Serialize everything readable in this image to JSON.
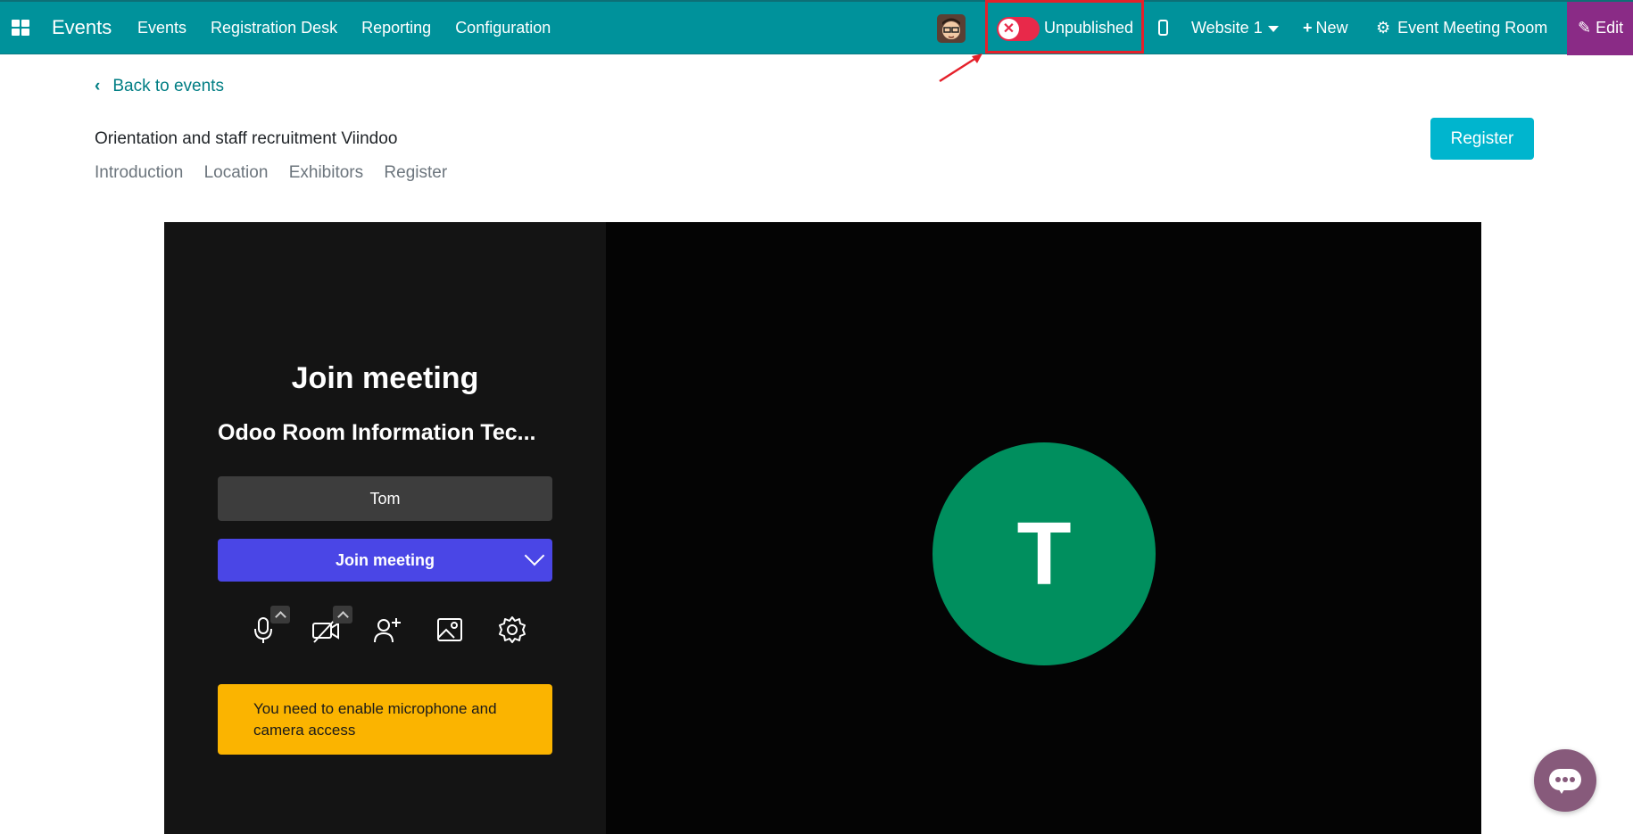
{
  "navbar": {
    "app_name": "Events",
    "menu": [
      "Events",
      "Registration Desk",
      "Reporting",
      "Configuration"
    ],
    "publish_status": "Unpublished",
    "website": "Website 1",
    "new_label": "New",
    "room_label": "Event Meeting Room",
    "edit_label": "Edit",
    "colors": {
      "bar": "#00929b",
      "edit": "#8a2b86",
      "toggle": "#e8294a",
      "highlight_box": "#e5202a"
    }
  },
  "page": {
    "back_label": "Back to events",
    "event_title": "Orientation and staff recruitment Viindoo",
    "tabs": [
      "Introduction",
      "Location",
      "Exhibitors",
      "Register"
    ],
    "register_label": "Register"
  },
  "meeting": {
    "join_title": "Join meeting",
    "room_name": "Odoo Room Information Tec...",
    "participant_name": "Tom",
    "join_button": "Join meeting",
    "tools": [
      "microphone-icon",
      "camera-off-icon",
      "invite-icon",
      "background-icon",
      "settings-icon"
    ],
    "warning": "You need to enable microphone and camera access",
    "avatar_initial": "T",
    "colors": {
      "join": "#4a46e6",
      "warning": "#fbb400",
      "avatar": "#008f5e"
    }
  },
  "chat": {
    "icon": "chat-bubble-icon",
    "color": "#875a7b"
  }
}
